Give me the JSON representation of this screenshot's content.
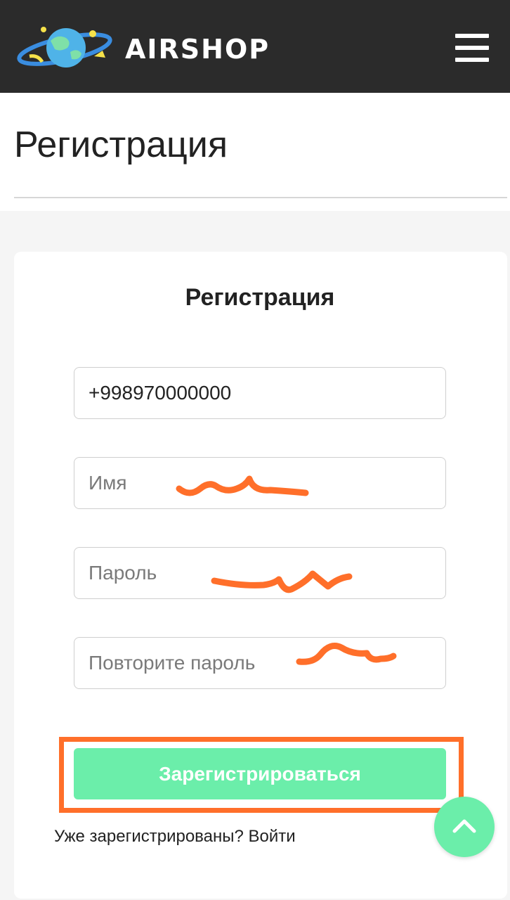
{
  "header": {
    "brand": "AIRSHOP",
    "logo_icon": "planet-logo-icon",
    "menu_icon": "hamburger-menu-icon",
    "background": "#2b2b2b"
  },
  "page": {
    "title": "Регистрация"
  },
  "form": {
    "title": "Регистрация",
    "phone_value": "+998970000000",
    "name_placeholder": "Имя",
    "password_placeholder": "Пароль",
    "repeat_password_placeholder": "Повторите пароль",
    "submit_label": "Зарегистрироваться",
    "accent_color": "#6beeaa",
    "annotation_color": "#ff6f2a"
  },
  "footer": {
    "already_registered": "Уже зарегистрированы?",
    "login_link": "Войти"
  },
  "scroll_top": {
    "icon": "chevron-up-icon"
  }
}
